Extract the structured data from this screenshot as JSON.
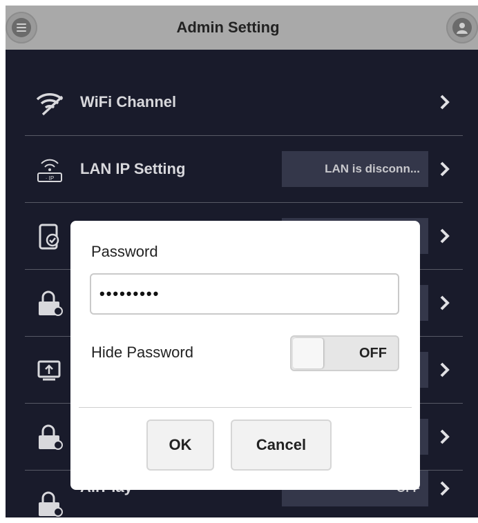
{
  "header": {
    "title": "Admin Setting",
    "left_icon": "menu-icon",
    "right_icon": "user-icon"
  },
  "rows": [
    {
      "label": "WiFi Channel",
      "value": "",
      "icon": "wifi-icon"
    },
    {
      "label": "LAN IP Setting",
      "value": "LAN is disconn...",
      "icon": "lan-ip-icon"
    },
    {
      "label": "",
      "value": "",
      "icon": "tablet-check-icon"
    },
    {
      "label": "",
      "value": "",
      "icon": "lock-network-icon"
    },
    {
      "label": "",
      "value": "",
      "icon": "screen-share-icon"
    },
    {
      "label": "",
      "value": "",
      "icon": "lock-network-icon"
    },
    {
      "label": "AirPlay",
      "value": "OFF",
      "icon": "lock-network-icon"
    }
  ],
  "dialog": {
    "password_label": "Password",
    "password_value": "•••••••••",
    "hide_password_label": "Hide Password",
    "toggle_state": "OFF",
    "ok_label": "OK",
    "cancel_label": "Cancel"
  },
  "colors": {
    "background": "#191b2b",
    "header": "#a9a9a9",
    "value_box": "#34374a",
    "dialog": "#ffffff"
  }
}
